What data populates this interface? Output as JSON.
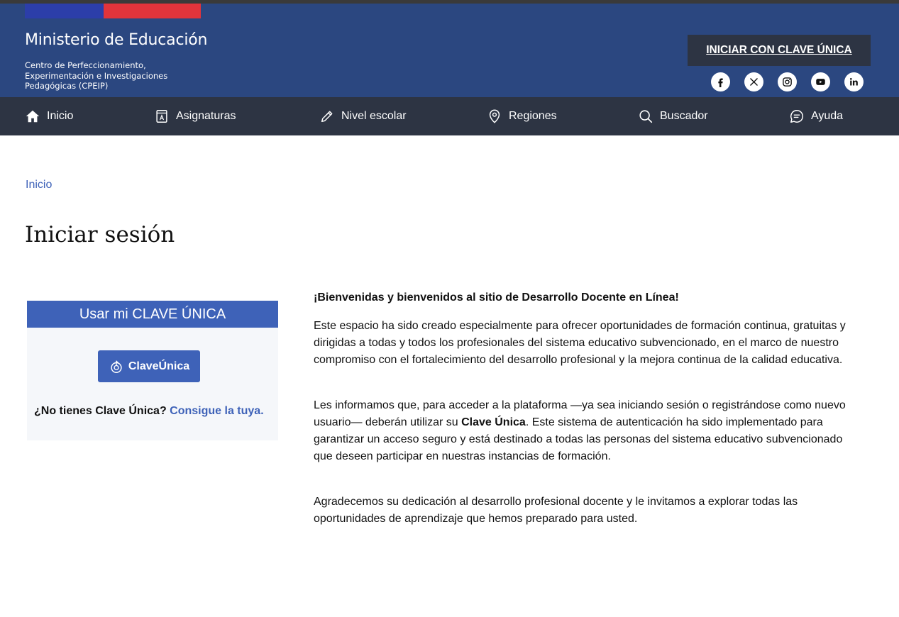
{
  "header": {
    "brand_title": "Ministerio de Educación",
    "brand_subtitle": "Centro de Perfeccionamiento, Experimentación e Investigaciones Pedagógicas (CPEIP)",
    "login_button": "INICIAR CON CLAVE ÚNICA",
    "flag_colors": [
      "#2c3ea9",
      "#e1343b"
    ],
    "socials": [
      "facebook-icon",
      "x-icon",
      "instagram-icon",
      "youtube-icon",
      "linkedin-icon"
    ]
  },
  "nav": {
    "items": [
      {
        "label": "Inicio",
        "icon": "home-icon"
      },
      {
        "label": "Asignaturas",
        "icon": "book-icon"
      },
      {
        "label": "Nivel escolar",
        "icon": "pencil-icon"
      },
      {
        "label": "Regiones",
        "icon": "location-pin-icon"
      },
      {
        "label": "Buscador",
        "icon": "search-icon"
      },
      {
        "label": "Ayuda",
        "icon": "chat-bubble-icon"
      }
    ]
  },
  "breadcrumb": {
    "home": "Inicio"
  },
  "page": {
    "title": "Iniciar sesión"
  },
  "login_card": {
    "heading": "Usar mi CLAVE ÚNICA",
    "button": "ClaveÚnica",
    "no_account_text": "¿No tienes Clave Única?",
    "no_account_link": "Consigue la tuya."
  },
  "content": {
    "welcome": "¡Bienvenidas y bienvenidos al sitio de Desarrollo Docente en Línea!",
    "p1": "Este espacio ha sido creado especialmente para ofrecer oportunidades de formación continua, gratuitas y dirigidas a todas y todos los profesionales del sistema educativo subvencionado, en el marco de nuestro compromiso con el fortalecimiento del desarrollo profesional y la mejora continua de la calidad educativa.",
    "p2_before": "Les informamos que, para acceder a la plataforma —ya sea iniciando sesión o registrándose como nuevo usuario— deberán utilizar su ",
    "p2_bold": "Clave Única",
    "p2_after": ". Este sistema de autenticación ha sido implementado para garantizar un acceso seguro y está destinado a todas las personas del sistema educativo subvencionado que deseen participar en nuestras instancias de formación.",
    "p3": "Agradecemos su dedicación al desarrollo profesional docente y le invitamos a explorar todas las oportunidades de aprendizaje que hemos preparado para usted."
  },
  "colors": {
    "header_bg": "#2b4780",
    "nav_bg": "#2d3443",
    "accent": "#3e62b8"
  }
}
